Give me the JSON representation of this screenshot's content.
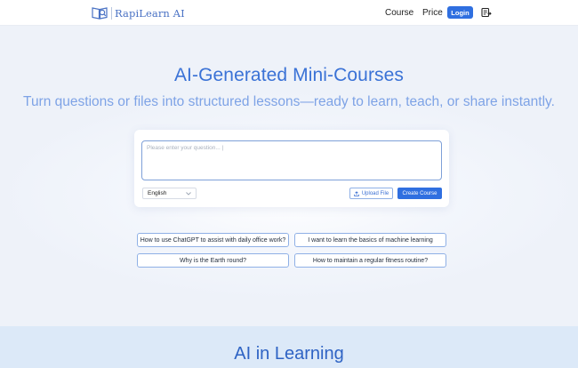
{
  "navbar": {
    "logo_text": "RapiLearn AI",
    "links": [
      {
        "label": "Course"
      },
      {
        "label": "Price"
      }
    ],
    "login_label": "Login",
    "language_icon": "language-switch-icon"
  },
  "hero": {
    "title": "AI-Generated Mini-Courses",
    "subtitle": "Turn questions or files into structured lessons—ready to learn, teach, or share instantly."
  },
  "input_card": {
    "question_value": "",
    "question_placeholder": "Please enter your question... |",
    "language_selected": "English",
    "upload_label": "Upload File",
    "create_label": "Create Course"
  },
  "suggestions": [
    {
      "text": "How to use ChatGPT to assist with daily office work?"
    },
    {
      "text": "I want to learn the basics of machine learning"
    },
    {
      "text": "Why is the Earth round?"
    },
    {
      "text": "How to maintain a regular fitness routine?"
    }
  ],
  "section2": {
    "title": "AI in Learning"
  },
  "colors": {
    "accent": "#2f6fe0",
    "title": "#3a72d6",
    "subtitle": "#7ea3e6",
    "section2_bg": "#dce9f8"
  }
}
